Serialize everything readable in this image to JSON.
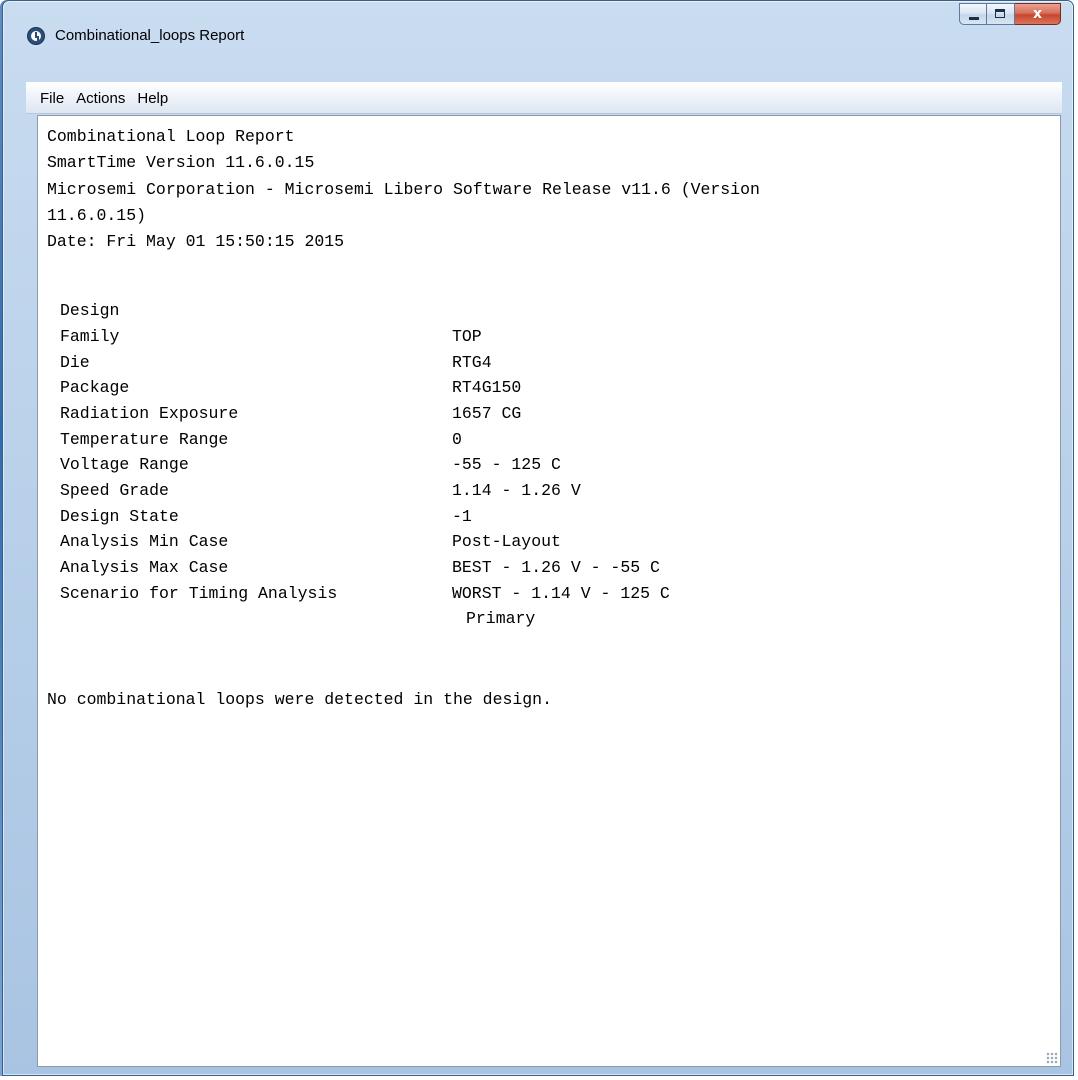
{
  "window": {
    "title": "Combinational_loops Report",
    "close_symbol": "x"
  },
  "menu": {
    "items": [
      "File",
      "Actions",
      "Help"
    ]
  },
  "report": {
    "header_lines": [
      "Combinational Loop Report",
      "SmartTime Version 11.6.0.15",
      "Microsemi Corporation - Microsemi Libero Software Release v11.6 (Version",
      "11.6.0.15)",
      "Date: Fri May 01 15:50:15 2015"
    ],
    "properties": [
      {
        "key": "Design",
        "value": "TOP"
      },
      {
        "key": "Family",
        "value": "RTG4"
      },
      {
        "key": "Die",
        "value": "RT4G150"
      },
      {
        "key": "Package",
        "value": "1657 CG"
      },
      {
        "key": "Radiation Exposure",
        "value": "0"
      },
      {
        "key": "Temperature Range",
        "value": "-55 - 125 C"
      },
      {
        "key": "Voltage Range",
        "value": "1.14 - 1.26 V"
      },
      {
        "key": "Speed Grade",
        "value": "-1"
      },
      {
        "key": "Design State",
        "value": "Post-Layout"
      },
      {
        "key": "Analysis Min Case",
        "value": "BEST - 1.26 V - -55 C"
      },
      {
        "key": "Analysis Max Case",
        "value": "WORST - 1.14 V - 125 C"
      },
      {
        "key": "Scenario for Timing Analysis",
        "value": "Primary"
      }
    ],
    "result": "No combinational loops were detected in the design."
  }
}
